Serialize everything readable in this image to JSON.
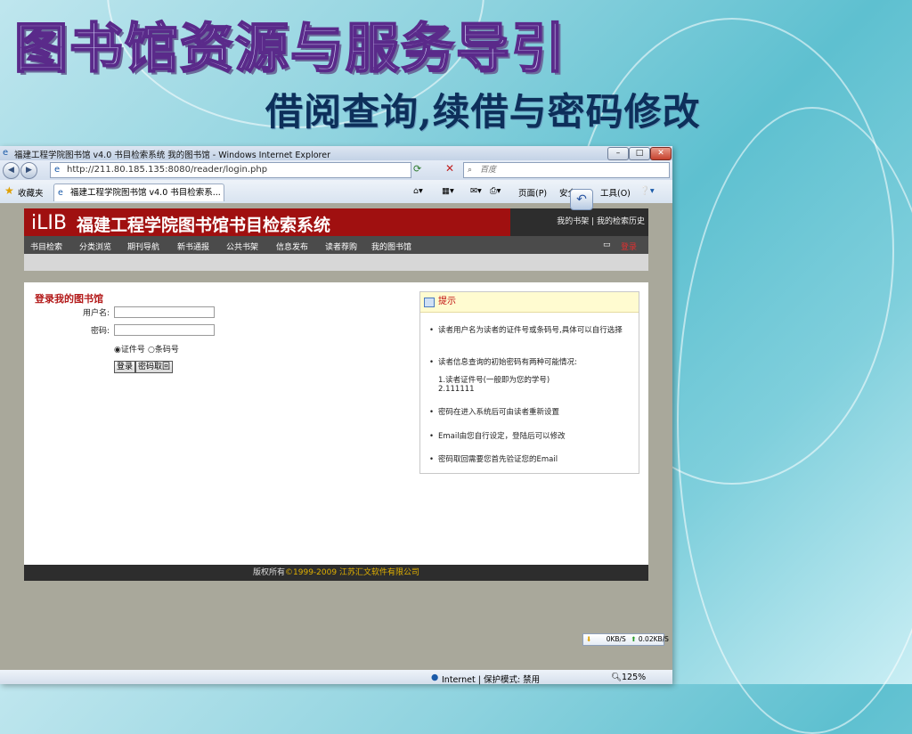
{
  "slide": {
    "title": "图书馆资源与服务导引",
    "subtitle": "借阅查询,续借与密码修改"
  },
  "browser": {
    "window_title": "福建工程学院图书馆 v4.0 书目检索系统 我的图书馆 - Windows Internet Explorer",
    "address": "http://211.80.185.135:8080/reader/login.php",
    "search_placeholder": "百度",
    "favorites_label": "收藏夹",
    "tab_label": "福建工程学院图书馆 v4.0 书目检索系...",
    "cmd_page": "页面(P)",
    "cmd_safety": "安全",
    "cmd_tools": "工具(O)",
    "status_zone": "Internet | 保护模式: 禁用",
    "zoom": "125%",
    "speed_down": "0KB/S",
    "speed_up": "0.02KB/S"
  },
  "site": {
    "logo": "iLIB",
    "title": "福建工程学院图书馆书目检索系统",
    "top_links": "我的书架 | 我的检索历史",
    "menu": [
      "书目检索",
      "分类浏览",
      "期刊导航",
      "新书通报",
      "公共书架",
      "信息发布",
      "读者荐购",
      "我的图书馆"
    ],
    "login_link": "登录",
    "login": {
      "heading": "登录我的图书馆",
      "username_label": "用户名:",
      "password_label": "密码:",
      "radio_card": "证件号",
      "radio_barcode": "条码号",
      "login_button": "登录",
      "recover_button": "密码取回"
    },
    "hint": {
      "heading": "提示",
      "items": [
        "读者用户名为读者的证件号或条码号,具体可以自行选择",
        "读者信息查询的初始密码有两种可能情况:",
        "1.读者证件号(一般即为您的学号)",
        "2.111111",
        "密码在进入系统后可由读者重新设置",
        "Email由您自行设定，登陆后可以修改",
        "密码取回需要您首先验证您的Email"
      ]
    },
    "footer_prefix": "版权所有",
    "footer_years": "©1999-2009",
    "footer_company": "江苏汇文软件有限公司"
  }
}
